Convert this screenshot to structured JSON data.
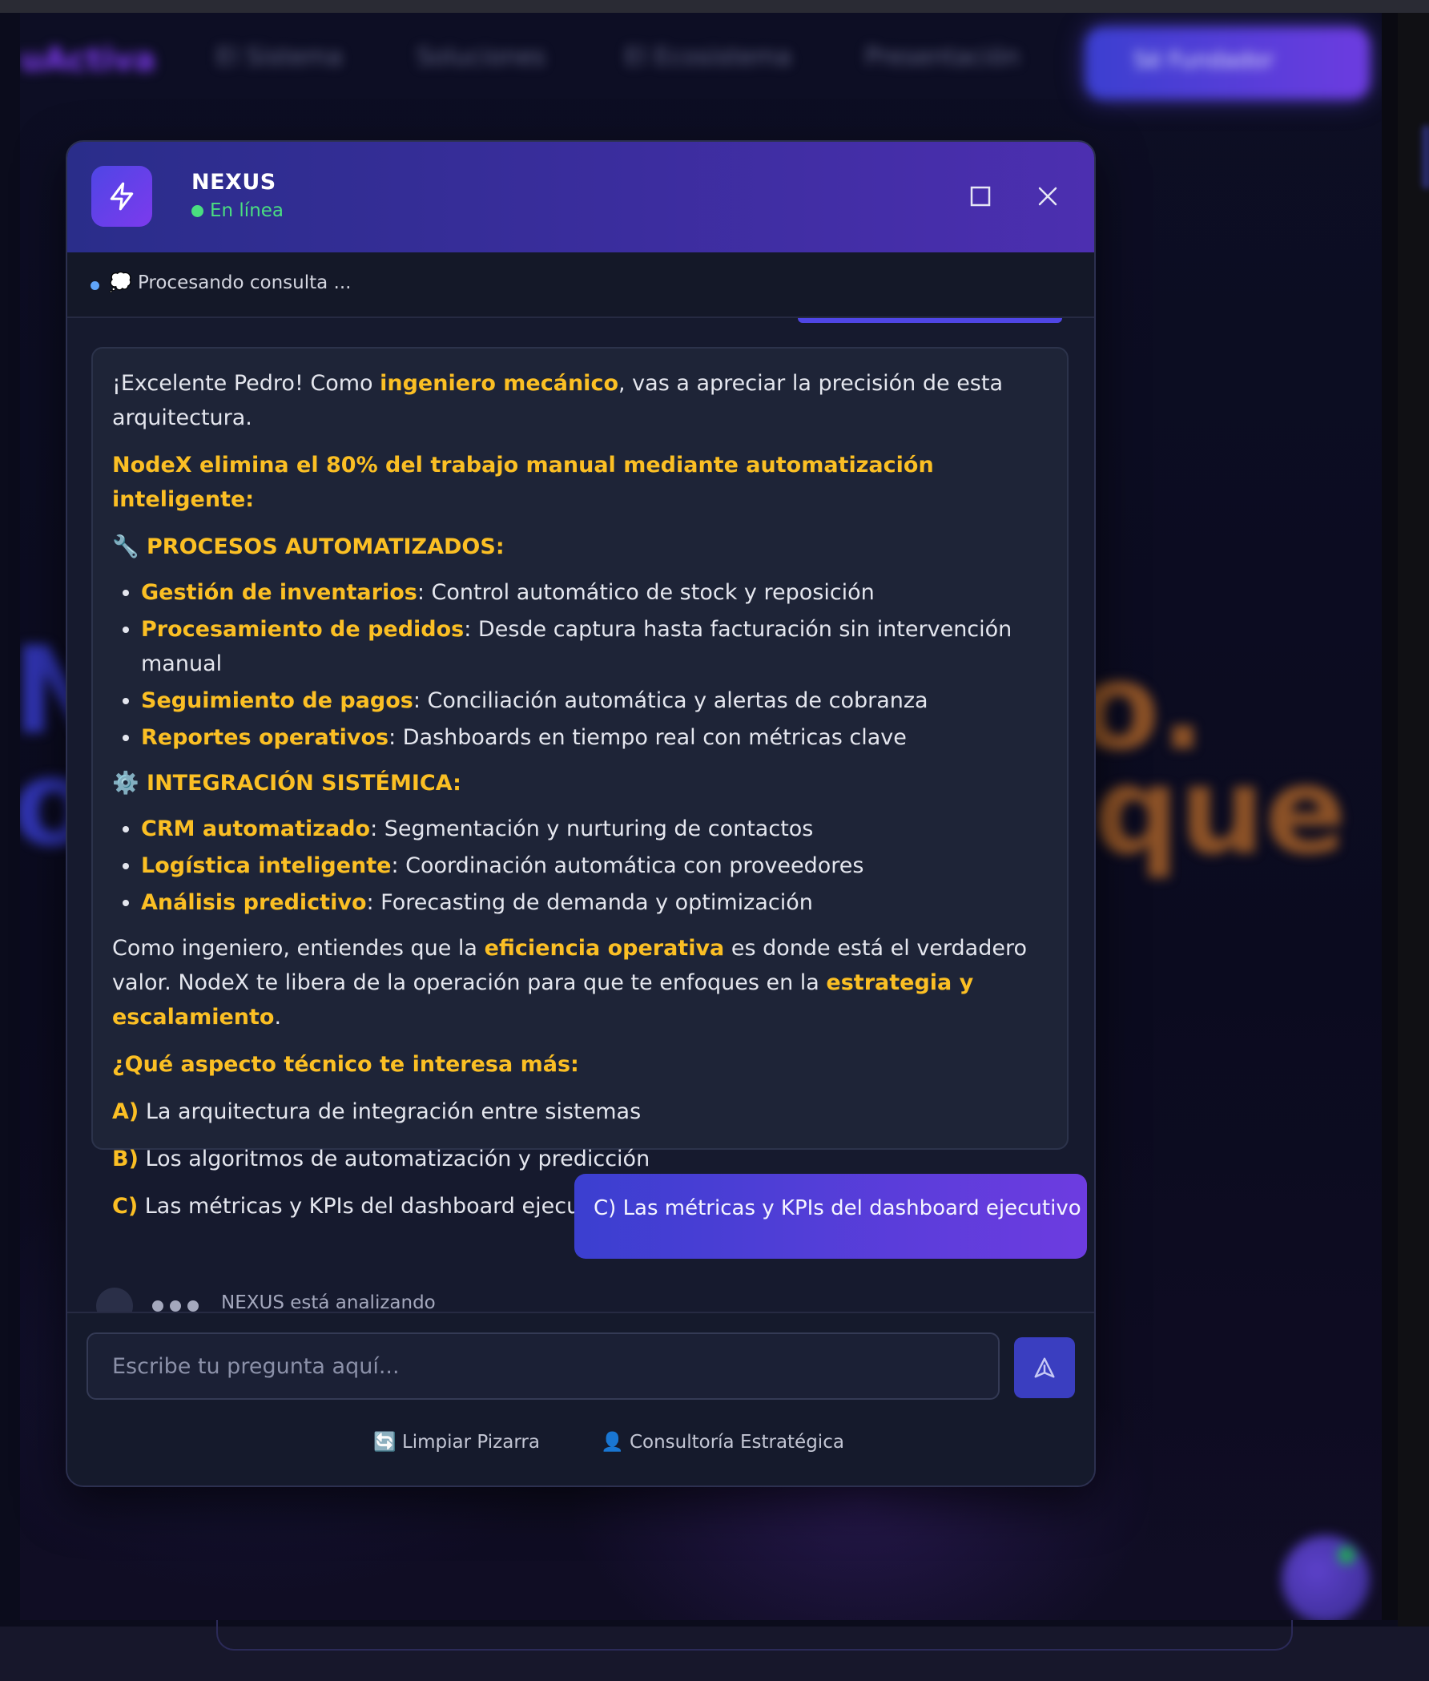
{
  "background_page": {
    "nav": {
      "logo": "uActiva",
      "items": [
        "El Sistema",
        "Soluciones",
        "El Ecosistema",
        "Presentación"
      ],
      "cta": "Sé Fundador"
    },
    "hero": {
      "left_line1": "N",
      "left_line2": "o",
      "right_line1": "o.",
      "right_line2": "que"
    }
  },
  "chat": {
    "title": "NEXUS",
    "status": "En línea",
    "status_color": "#4ade80",
    "processing_text": "💭 Procesando consulta ...",
    "bot_message": {
      "intro_pre": "¡Excelente Pedro! Como ",
      "intro_hl": "ingeniero mecánico",
      "intro_post": ", vas a apreciar la precisión de esta arquitectura.",
      "headline": "NodeX elimina el 80% del trabajo manual mediante automatización inteligente:",
      "section1_title": "🔧 PROCESOS AUTOMATIZADOS:",
      "section1_items": [
        {
          "label": "Gestión de inventarios",
          "text": ": Control automático de stock y reposición"
        },
        {
          "label": "Procesamiento de pedidos",
          "text": ": Desde captura hasta facturación sin intervención manual"
        },
        {
          "label": "Seguimiento de pagos",
          "text": ": Conciliación automática y alertas de cobranza"
        },
        {
          "label": "Reportes operativos",
          "text": ": Dashboards en tiempo real con métricas clave"
        }
      ],
      "section2_title": "⚙️ INTEGRACIÓN SISTÉMICA:",
      "section2_items": [
        {
          "label": "CRM automatizado",
          "text": ": Segmentación y nurturing de contactos"
        },
        {
          "label": "Logística inteligente",
          "text": ": Coordinación automática con proveedores"
        },
        {
          "label": "Análisis predictivo",
          "text": ": Forecasting de demanda y optimización"
        }
      ],
      "closing_pre": "Como ingeniero, entiendes que la ",
      "closing_hl1": "eficiencia operativa",
      "closing_mid": " es donde está el verdadero valor. NodeX te libera de la operación para que te enfoques en la ",
      "closing_hl2": "estrategia y escalamiento",
      "closing_post": ".",
      "question": "¿Qué aspecto técnico te interesa más:",
      "options": [
        {
          "key": "A)",
          "text": " La arquitectura de integración entre sistemas"
        },
        {
          "key": "B)",
          "text": " Los algoritmos de automatización y predicción"
        },
        {
          "key": "C)",
          "text": " Las métricas y KPIs del dashboard ejecutivo"
        }
      ]
    },
    "user_message": "C) Las métricas y KPIs del dashboard ejecutivo",
    "typing_text": "NEXUS está analizando",
    "input_placeholder": "Escribe tu pregunta aquí...",
    "quick_actions": {
      "clear": "🔄 Limpiar Pizarra",
      "consult": "👤 Consultoría Estratégica"
    },
    "highlight_color": "#fbbf24"
  }
}
